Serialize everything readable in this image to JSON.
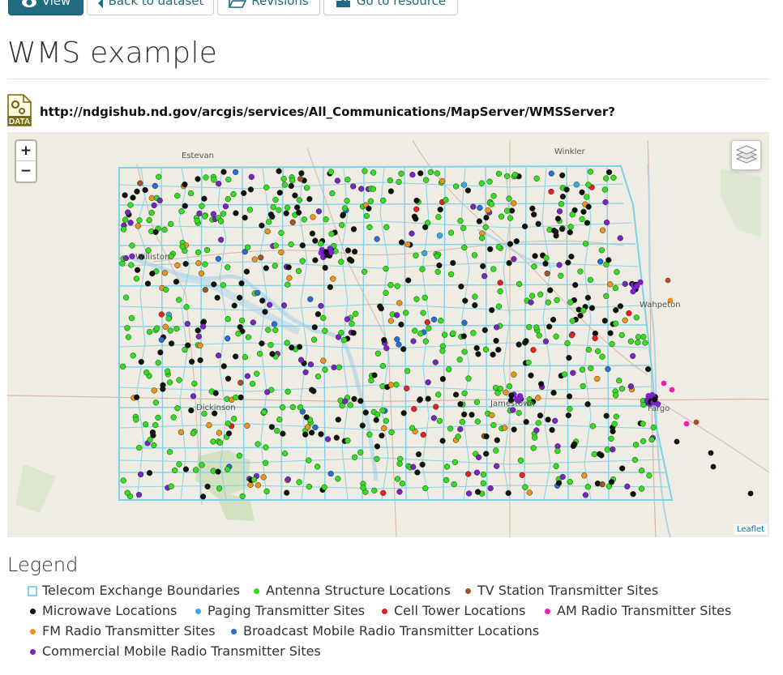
{
  "toolbar": {
    "view_label": "View",
    "back_label": "Back to dataset",
    "revisions_label": "Revisions",
    "goto_label": "Go to resource"
  },
  "page": {
    "title": "WMS example",
    "resource_format_badge": "DATA",
    "resource_url": "http://ndgishub.nd.gov/arcgis/services/All_Communications/MapServer/WMSServer?"
  },
  "map": {
    "zoom_in_label": "+",
    "zoom_out_label": "−",
    "attribution": "Leaflet",
    "place_labels": [
      "Estevan",
      "Winkler",
      "Williston",
      "Dickinson",
      "Jamestown",
      "Wahpeton",
      "Fargo"
    ],
    "base_colors": {
      "land": "#efece3",
      "boundary": "#7fd1ea",
      "water": "#c7dde9",
      "road": "#d9b7a6",
      "park": "#d2e2c0"
    }
  },
  "legend": {
    "title": "Legend",
    "items": [
      {
        "label": "Telecom Exchange Boundaries",
        "color": "#7fd1ea",
        "symbol": "box"
      },
      {
        "label": "Antenna Structure Locations",
        "color": "#33dd22",
        "symbol": "dot"
      },
      {
        "label": "TV Station Transmitter Sites",
        "color": "#a0522d",
        "symbol": "dot"
      },
      {
        "label": "Microwave Locations",
        "color": "#111111",
        "symbol": "dot"
      },
      {
        "label": "Paging Transmitter Sites",
        "color": "#3aa7e0",
        "symbol": "dot"
      },
      {
        "label": "Cell Tower Locations",
        "color": "#ee1c24",
        "symbol": "dot"
      },
      {
        "label": "AM Radio Transmitter Sites",
        "color": "#ee22aa",
        "symbol": "dot"
      },
      {
        "label": "FM Radio Transmitter Sites",
        "color": "#f0901e",
        "symbol": "dot"
      },
      {
        "label": "Broadcast Mobile Radio Transmitter Locations",
        "color": "#2b6bdc",
        "symbol": "dot"
      },
      {
        "label": "Commercial Mobile Radio Transmitter Sites",
        "color": "#7a22c8",
        "symbol": "dot"
      }
    ]
  },
  "colors": {
    "primary_button": "#206b82",
    "link": "#206b82"
  }
}
